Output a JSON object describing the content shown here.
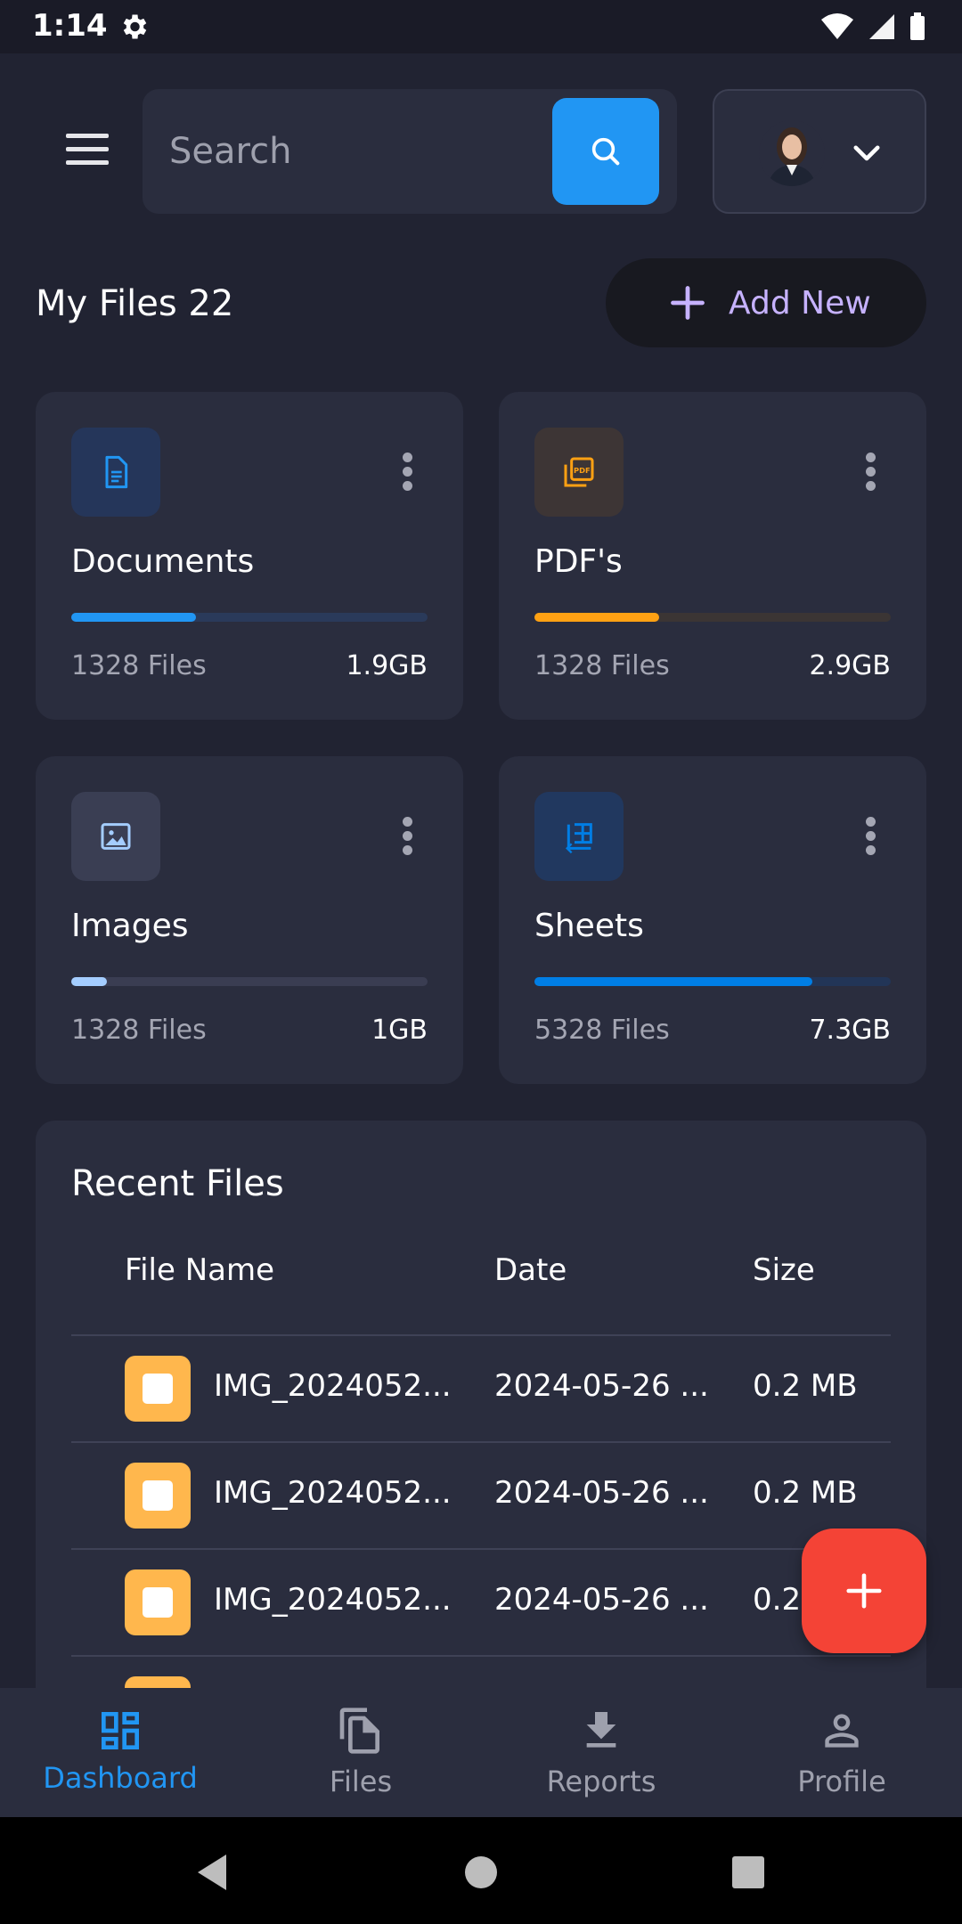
{
  "status_bar": {
    "time": "1:14"
  },
  "header": {
    "search_placeholder": "Search"
  },
  "files": {
    "title": "My Files 22",
    "add_new_label": "Add New"
  },
  "cards": [
    {
      "title": "Documents",
      "count": "1328 Files",
      "size": "1.9GB",
      "icon": "document-icon",
      "progress": 0.35,
      "color": "#2196f3",
      "icon_bg": "#25365a",
      "track_color": "#2a3a5a"
    },
    {
      "title": "PDF's",
      "count": "1328 Files",
      "size": "2.9GB",
      "icon": "pdf-icon",
      "progress": 0.35,
      "color": "#ffa113",
      "icon_bg": "#3d3535",
      "track_color": "#3b3534"
    },
    {
      "title": "Images",
      "count": "1328 Files",
      "size": "1GB",
      "icon": "image-icon",
      "progress": 0.1,
      "color": "#a4cdff",
      "icon_bg": "#3a3e53",
      "track_color": "#3a3d52"
    },
    {
      "title": "Sheets",
      "count": "5328 Files",
      "size": "7.3GB",
      "icon": "sheets-icon",
      "progress": 0.78,
      "color": "#007ee5",
      "icon_bg": "#21385f",
      "track_color": "#223557"
    }
  ],
  "recent": {
    "title": "Recent Files",
    "columns": [
      "File Name",
      "Date",
      "Size"
    ],
    "rows": [
      {
        "name": "IMG_2024052...",
        "date": "2024-05-26 ...",
        "size": "0.2 MB"
      },
      {
        "name": "IMG_2024052...",
        "date": "2024-05-26 ...",
        "size": "0.2 MB"
      },
      {
        "name": "IMG_2024052...",
        "date": "2024-05-26 ...",
        "size": "0.2"
      }
    ]
  },
  "bottom_nav": [
    {
      "label": "Dashboard",
      "icon": "dashboard-icon",
      "active": true
    },
    {
      "label": "Files",
      "icon": "files-icon",
      "active": false
    },
    {
      "label": "Reports",
      "icon": "download-icon",
      "active": false
    },
    {
      "label": "Profile",
      "icon": "person-icon",
      "active": false
    }
  ],
  "colors": {
    "background": "#212332",
    "surface": "#2a2d3e",
    "accent": "#2196f3",
    "fab": "#f44336",
    "add_new_text": "#c6b2ff"
  }
}
